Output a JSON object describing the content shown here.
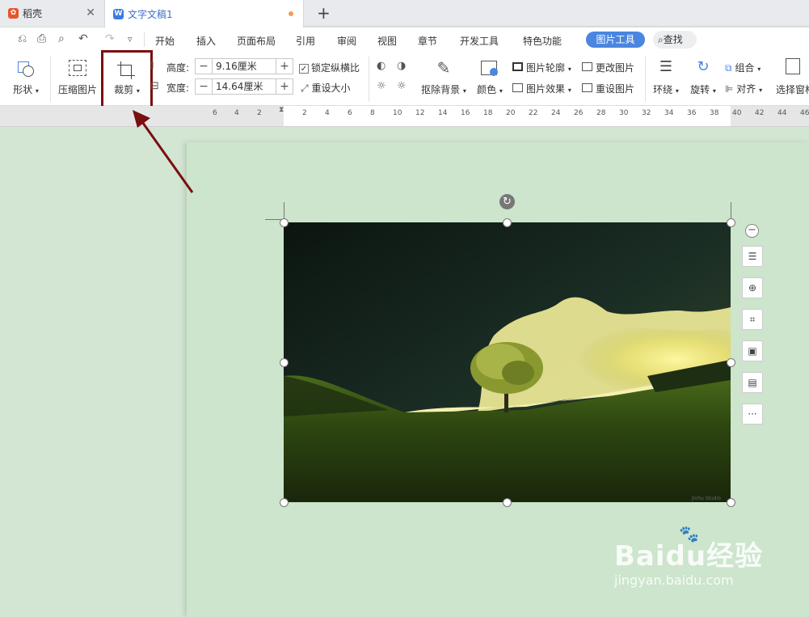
{
  "tabs": [
    {
      "label": "稻壳",
      "icon": "docer-logo-icon",
      "close": "✕"
    },
    {
      "label": "文字文稿1",
      "icon": "wps-writer-icon"
    }
  ],
  "new_tab": "+",
  "menu": [
    "开始",
    "插入",
    "页面布局",
    "引用",
    "审阅",
    "视图",
    "章节",
    "开发工具",
    "特色功能"
  ],
  "active_tab": "图片工具",
  "search_label": "查找",
  "ribbon": {
    "shape": "形状",
    "compress": "压缩图片",
    "crop": "裁剪",
    "height_label": "高度:",
    "height_value": "9.16厘米",
    "width_label": "宽度:",
    "width_value": "14.64厘米",
    "lock_ratio": "锁定纵横比",
    "reset_size": "重设大小",
    "remove_bg": "抠除背景",
    "color": "颜色",
    "outline": "图片轮廓",
    "effect": "图片效果",
    "change_pic": "更改图片",
    "reset_pic": "重设图片",
    "wrap": "环绕",
    "rotate": "旋转",
    "group": "组合",
    "align": "对齐",
    "select_pane": "选择窗格",
    "minus": "−",
    "plus": "+"
  },
  "ruler_ticks": [
    "6",
    "4",
    "2",
    "2",
    "4",
    "6",
    "8",
    "10",
    "12",
    "14",
    "16",
    "18",
    "20",
    "22",
    "24",
    "26",
    "28",
    "30",
    "32",
    "34",
    "36",
    "38",
    "40",
    "42",
    "44",
    "46"
  ],
  "photo_credit": "Jinhu Studio",
  "side_more": "···",
  "watermark": {
    "main": "Baidu经验",
    "sub": "jingyan.baidu.com"
  },
  "colors": {
    "accent": "#4a86e0",
    "highlight_box": "#7a0f0f",
    "page_bg": "#cce5cc"
  }
}
